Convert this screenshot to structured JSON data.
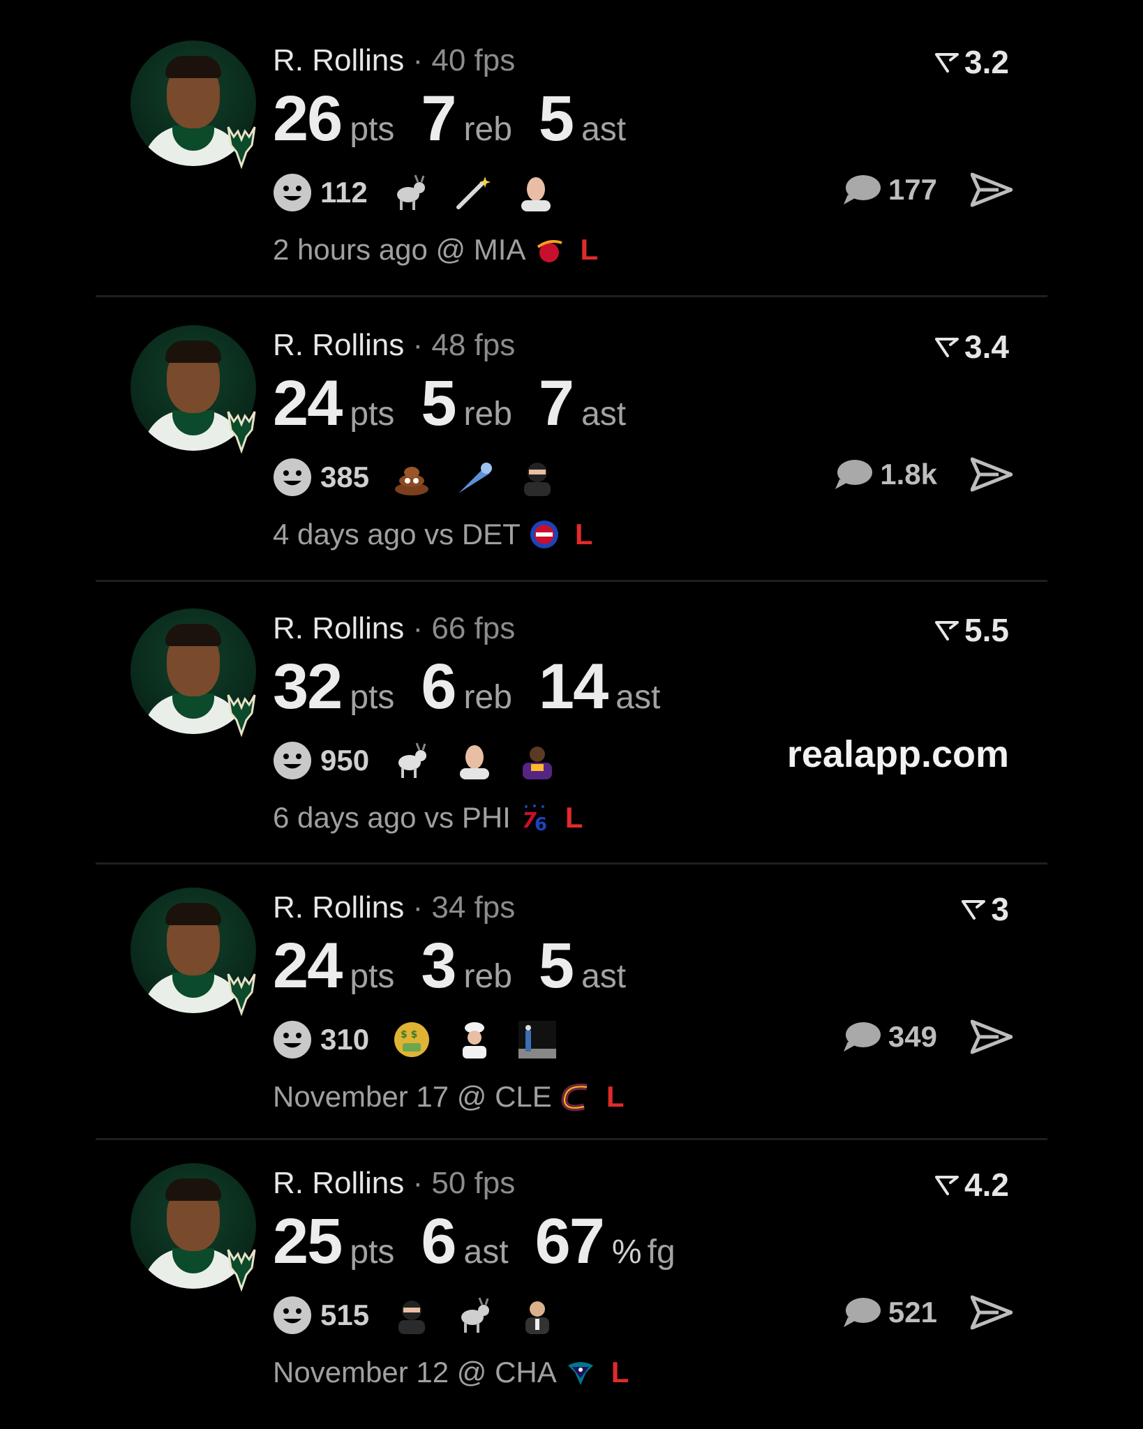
{
  "posts": [
    {
      "name": "R. Rollins",
      "sep": " · ",
      "fps": "40 fps",
      "rating": "3.2",
      "stats": [
        {
          "num": "26",
          "unit": "pts"
        },
        {
          "num": "7",
          "unit": "reb"
        },
        {
          "num": "5",
          "unit": "ast"
        }
      ],
      "reaction_count": "112",
      "emojis": [
        "goat-icon",
        "magic-wand-icon",
        "masked-face-icon"
      ],
      "comment_count": "177",
      "time": "2 hours ago @ MIA",
      "team_logo": "heat-logo",
      "result": "L"
    },
    {
      "name": "R. Rollins",
      "sep": " · ",
      "fps": "48 fps",
      "rating": "3.4",
      "stats": [
        {
          "num": "24",
          "unit": "pts"
        },
        {
          "num": "5",
          "unit": "reb"
        },
        {
          "num": "7",
          "unit": "ast"
        }
      ],
      "reaction_count": "385",
      "emojis": [
        "poop-icon",
        "comet-icon",
        "ninja-icon"
      ],
      "comment_count": "1.8k",
      "time": "4 days ago vs DET",
      "team_logo": "pistons-logo",
      "result": "L"
    },
    {
      "name": "R. Rollins",
      "sep": " · ",
      "fps": "66 fps",
      "rating": "5.5",
      "stats": [
        {
          "num": "32",
          "unit": "pts"
        },
        {
          "num": "6",
          "unit": "reb"
        },
        {
          "num": "14",
          "unit": "ast"
        }
      ],
      "reaction_count": "950",
      "emojis": [
        "goat-icon",
        "masked-face-icon",
        "player-photo-icon"
      ],
      "watermark": "realapp.com",
      "time": "6 days ago vs PHI",
      "team_logo": "76ers-logo",
      "result": "L"
    },
    {
      "name": "R. Rollins",
      "sep": " · ",
      "fps": "34 fps",
      "rating": "3",
      "stats": [
        {
          "num": "24",
          "unit": "pts"
        },
        {
          "num": "3",
          "unit": "reb"
        },
        {
          "num": "5",
          "unit": "ast"
        }
      ],
      "reaction_count": "310",
      "emojis": [
        "money-mouth-icon",
        "chef-icon",
        "dunk-photo-icon"
      ],
      "comment_count": "349",
      "time": "November 17 @ CLE",
      "team_logo": "cavaliers-logo",
      "result": "L"
    },
    {
      "name": "R. Rollins",
      "sep": " · ",
      "fps": "50 fps",
      "rating": "4.2",
      "stats": [
        {
          "num": "25",
          "unit": "pts"
        },
        {
          "num": "6",
          "unit": "ast"
        },
        {
          "num": "67",
          "unit": "%",
          "unit2": "fg"
        }
      ],
      "reaction_count": "515",
      "emojis": [
        "ninja-icon",
        "goat-icon",
        "person-photo-icon"
      ],
      "comment_count": "521",
      "time": "November 12 @ CHA",
      "team_logo": "hornets-logo",
      "result": "L"
    }
  ],
  "colors": {
    "background": "#000000",
    "loss": "#e02b2b",
    "muted": "#8d8d8d",
    "bucks_green": "#0b4a2a"
  }
}
